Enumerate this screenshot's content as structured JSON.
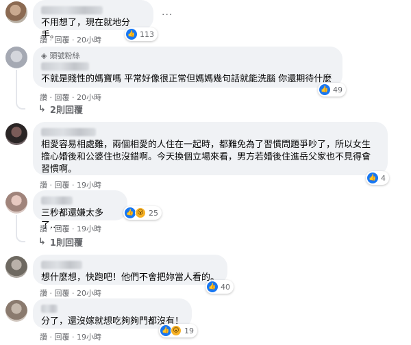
{
  "comments": [
    {
      "text": "不用想了，現在就地分手。",
      "actions": "讚 · 回覆 · 20小時",
      "reactions": {
        "count": "113"
      }
    },
    {
      "badge": "頭號粉絲",
      "text": "不就是賤性的媽寶嗎 平常好像很正常但媽媽幾句話就能洗腦 你還期待什麼",
      "actions": "讚 · 回覆 · 20小時",
      "reactions": {
        "count": "49"
      },
      "replies": "2則回覆"
    },
    {
      "text_lines": [
        "相愛容易相處難，兩個相愛的人住在一起時，都難免為了習慣問題爭吵了，所以女生",
        "擔心婚後和公婆住也沒錯啊。今天換個立場來看，男方若婚後住進岳父家也不見得會",
        "習慣啊。"
      ],
      "actions": "讚 · 回覆 · 19小時",
      "reactions": {
        "count": "4"
      }
    },
    {
      "text": "三秒都還嫌太多了....",
      "actions": "讚 · 回覆 · 19小時",
      "reactions": {
        "count": "25"
      },
      "replies": "1則回覆"
    },
    {
      "text": "想什麼想，快跑吧！他們不會把妳當人看的。",
      "actions": "讚 · 回覆 · 20小時",
      "reactions": {
        "count": "40"
      }
    },
    {
      "text": "分了，還沒嫁就想吃夠夠門都沒有！",
      "actions": "讚 · 回覆 · 19小時",
      "reactions": {
        "count": "19"
      }
    }
  ],
  "more_icon": "···",
  "icons": {
    "like": "like-icon",
    "wow": "wow-icon",
    "reply_arrow": "reply-arrow-icon",
    "more": "more-options-icon",
    "badge": "diamond-icon"
  }
}
